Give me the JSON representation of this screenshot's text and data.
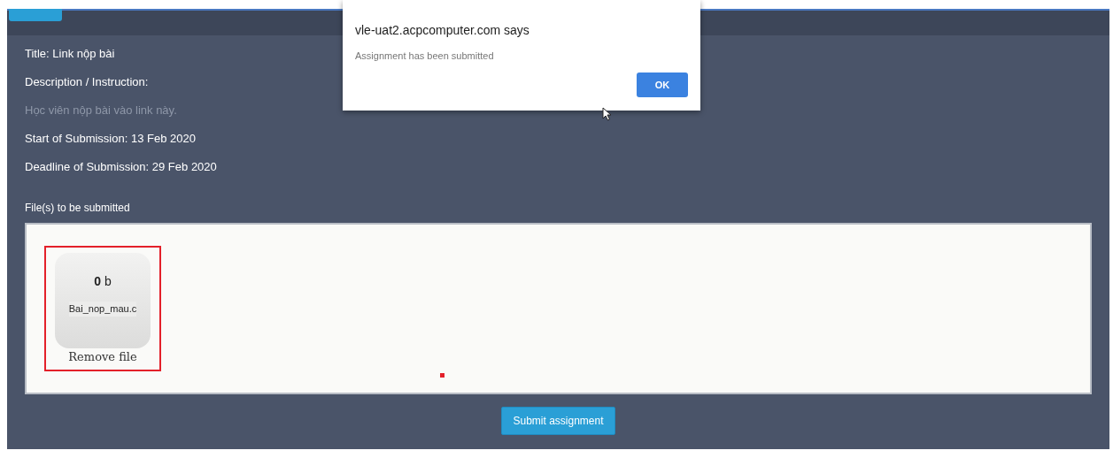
{
  "details": [
    {
      "kind": "field",
      "text": "Title: Link nộp bài"
    },
    {
      "kind": "field",
      "text": "Description / Instruction:"
    },
    {
      "kind": "muted",
      "text": "Học viên nộp bài vào link này."
    },
    {
      "kind": "field",
      "text": "Start of Submission: 13 Feb 2020"
    },
    {
      "kind": "field",
      "text": "Deadline of Submission: 29 Feb 2020"
    }
  ],
  "files_label": "File(s) to be submitted",
  "files": [
    {
      "size_number": "0",
      "size_unit": "b",
      "name": "Bai_nop_mau.c",
      "remove": "Remove file",
      "highlighted": true
    }
  ],
  "submit_button": "Submit assignment",
  "dialog": {
    "title": "vle-uat2.acpcomputer.com says",
    "message": "Assignment has been submitted",
    "button": "OK"
  }
}
